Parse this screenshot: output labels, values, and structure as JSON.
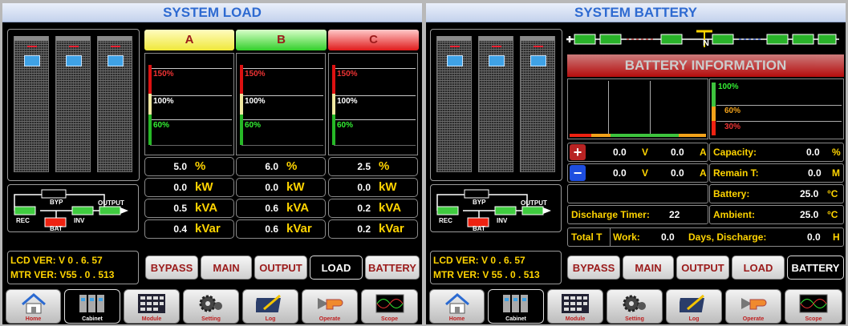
{
  "left": {
    "title": "SYSTEM LOAD",
    "phases": [
      {
        "label": "A",
        "color": "#f2ef3e",
        "pct": "5.0",
        "kw": "0.0",
        "kva": "0.5",
        "kvar": "0.4"
      },
      {
        "label": "B",
        "color": "#35d12d",
        "pct": "6.0",
        "kw": "0.0",
        "kva": "0.6",
        "kvar": "0.6"
      },
      {
        "label": "C",
        "color": "#e21d1d",
        "pct": "2.5",
        "kw": "0.0",
        "kva": "0.2",
        "kvar": "0.2"
      }
    ],
    "gauge_ticks": [
      "150%",
      "100%",
      "60%"
    ],
    "units": {
      "pct": "%",
      "kw": "kW",
      "kva": "kVA",
      "kvar": "kVar"
    },
    "diagram": {
      "byp": "BYP",
      "rec": "REC",
      "inv": "INV",
      "output": "OUTPUT",
      "bat": "BAT"
    },
    "lcd_ver": "LCD VER: V 0 .  6. 57",
    "mtr_ver": "MTR VER: V55 . 0 . 513",
    "tabs": [
      "BYPASS",
      "MAIN",
      "OUTPUT",
      "LOAD",
      "BATTERY"
    ],
    "selected_tab": "LOAD"
  },
  "right": {
    "title": "SYSTEM BATTERY",
    "battery_info": "BATTERY INFORMATION",
    "n_label": "N",
    "gauge_ticks": [
      "100%",
      "60%",
      "30%"
    ],
    "plus_row": {
      "v": "0.0",
      "vu": "V",
      "a": "0.0",
      "au": "A"
    },
    "minus_row": {
      "v": "0.0",
      "vu": "V",
      "a": "0.0",
      "au": "A"
    },
    "capacity": {
      "label": "Capacity:",
      "value": "0.0",
      "unit": "%"
    },
    "remain": {
      "label": "Remain T:",
      "value": "0.0",
      "unit": "M"
    },
    "battery": {
      "label": "Battery:",
      "value": "25.0",
      "unit": "°C"
    },
    "ambient": {
      "label": "Ambient:",
      "value": "25.0",
      "unit": "°C"
    },
    "discharge_timer": {
      "label": "Discharge Timer:",
      "value": "22"
    },
    "total": {
      "label": "Total T",
      "work": "Work:",
      "work_value": "0.0",
      "days": "Days, Discharge:",
      "discharge_value": "0.0",
      "unit": "H"
    },
    "diagram": {
      "byp": "BYP",
      "rec": "REC",
      "inv": "INV",
      "output": "OUTPUT",
      "bat": "BAT"
    },
    "lcd_ver": "LCD VER: V 0 .  6. 57",
    "mtr_ver": "MTR VER: V 55 . 0 .  513",
    "tabs": [
      "BYPASS",
      "MAIN",
      "OUTPUT",
      "LOAD",
      "BATTERY"
    ],
    "selected_tab": "BATTERY"
  },
  "nav": [
    "Home",
    "Cabinet",
    "Module",
    "Setting",
    "Log",
    "Operate",
    "Scope"
  ],
  "nav_selected": "Cabinet"
}
